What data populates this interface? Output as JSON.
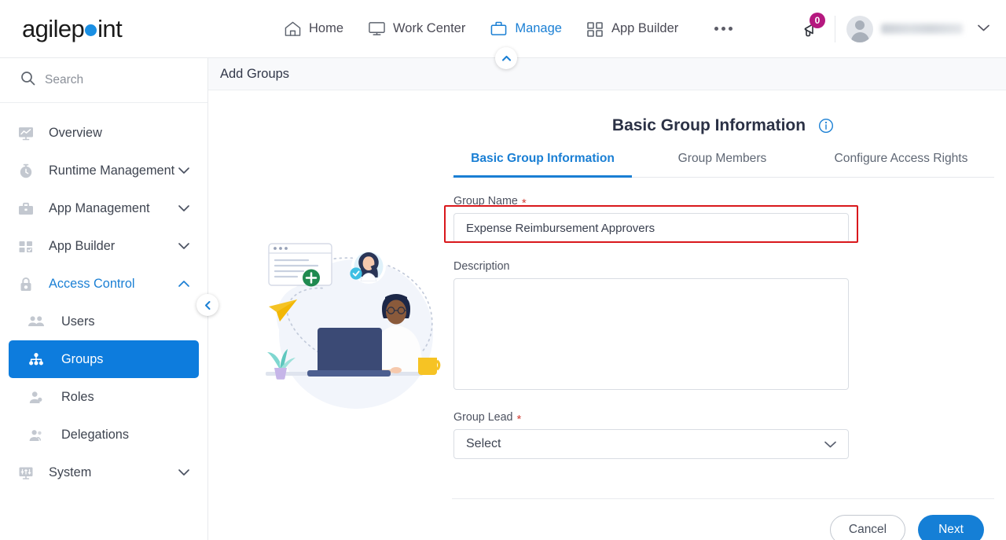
{
  "brand": {
    "name_part1": "agilep",
    "name_part2": "int",
    "dot_color": "#1a8fe3"
  },
  "topnav": {
    "items": [
      {
        "label": "Home",
        "icon": "home-icon",
        "active": false
      },
      {
        "label": "Work Center",
        "icon": "monitor-icon",
        "active": false
      },
      {
        "label": "Manage",
        "icon": "briefcase-icon",
        "active": true
      },
      {
        "label": "App Builder",
        "icon": "grid-icon",
        "active": false
      }
    ],
    "more_label": "...",
    "notification_count": "0",
    "notification_badge_color": "#b5187f",
    "username": ""
  },
  "sidebar": {
    "search_placeholder": "Search",
    "search_value": "",
    "items": [
      {
        "label": "Overview",
        "icon": "chart-monitor-icon",
        "expandable": false,
        "state": "normal"
      },
      {
        "label": "Runtime Management",
        "icon": "clock-icon",
        "expandable": true,
        "state": "normal"
      },
      {
        "label": "App Management",
        "icon": "briefcase-icon",
        "expandable": true,
        "state": "normal"
      },
      {
        "label": "App Builder",
        "icon": "grid-icon",
        "expandable": true,
        "state": "normal"
      },
      {
        "label": "Access Control",
        "icon": "lock-icon",
        "expandable": true,
        "state": "accent",
        "expanded": true
      }
    ],
    "sub_items": [
      {
        "label": "Users",
        "icon": "users-icon",
        "state": "normal"
      },
      {
        "label": "Groups",
        "icon": "group-tree-icon",
        "state": "selected"
      },
      {
        "label": "Roles",
        "icon": "role-person-icon",
        "state": "normal"
      },
      {
        "label": "Delegations",
        "icon": "delegation-person-icon",
        "state": "normal"
      }
    ],
    "bottom_items": [
      {
        "label": "System",
        "icon": "system-monitor-icon",
        "expandable": true,
        "state": "normal"
      }
    ],
    "collapse_icon": "chevron-left-icon",
    "selected_bg": "#0d7cdd",
    "accent_color": "#1a7fd4"
  },
  "page": {
    "header_title": "Add Groups",
    "collapse_up_icon": "chevron-up-icon"
  },
  "form": {
    "title": "Basic Group Information",
    "info_icon": "info-icon",
    "tabs": [
      {
        "label": "Basic Group Information",
        "active": true
      },
      {
        "label": "Group Members",
        "active": false
      },
      {
        "label": "Configure Access Rights",
        "active": false
      }
    ],
    "group_name": {
      "label": "Group Name",
      "required_marker": "*",
      "value": "Expense Reimbursement Approvers",
      "placeholder": "",
      "highlighted": true,
      "highlight_color": "#d9181c"
    },
    "description": {
      "label": "Description",
      "required_marker": "",
      "value": "",
      "placeholder": ""
    },
    "group_lead": {
      "label": "Group Lead",
      "required_marker": "*",
      "selected": "Select",
      "caret_icon": "chevron-down-icon"
    },
    "buttons": {
      "cancel": "Cancel",
      "next": "Next"
    }
  }
}
